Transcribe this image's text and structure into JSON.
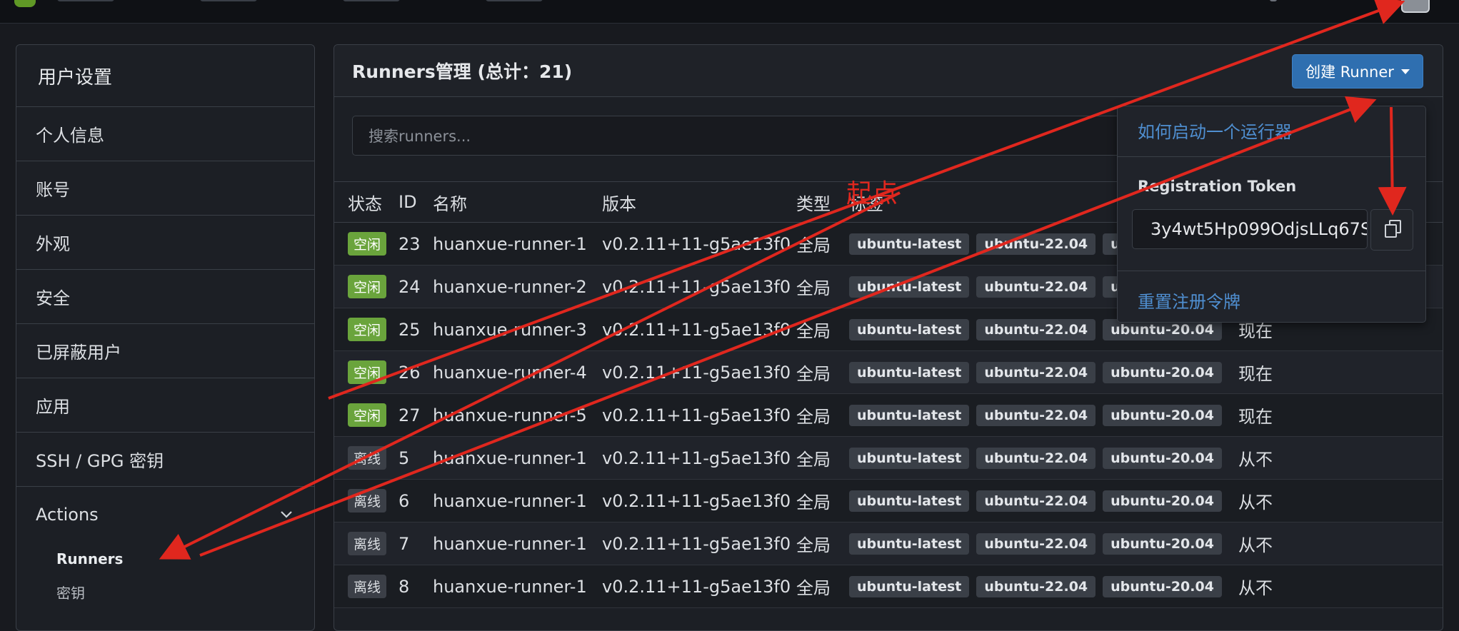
{
  "sidebar": {
    "title": "用户设置",
    "items": [
      {
        "label": "个人信息"
      },
      {
        "label": "账号"
      },
      {
        "label": "外观"
      },
      {
        "label": "安全"
      },
      {
        "label": "已屏蔽用户"
      },
      {
        "label": "应用"
      },
      {
        "label": "SSH / GPG 密钥"
      }
    ],
    "actions": {
      "label": "Actions",
      "chevron_icon": "chevron-down-icon",
      "subitems": [
        {
          "label": "Runners"
        },
        {
          "label": "密钥"
        }
      ]
    }
  },
  "main": {
    "title": "Runners管理 (总计：21)",
    "create_button": "创建 Runner",
    "search_placeholder": "搜索runners...",
    "columns": [
      "状态",
      "ID",
      "名称",
      "版本",
      "类型",
      "标签"
    ],
    "rows": [
      {
        "status": "空闲",
        "id": "23",
        "name": "huanxue-runner-1",
        "version": "v0.2.11+11-g5ae13f0",
        "type": "全局",
        "labels": [
          "ubuntu-latest",
          "ubuntu-22.04",
          "ub"
        ],
        "last": ""
      },
      {
        "status": "空闲",
        "id": "24",
        "name": "huanxue-runner-2",
        "version": "v0.2.11+11-g5ae13f0",
        "type": "全局",
        "labels": [
          "ubuntu-latest",
          "ubuntu-22.04",
          "ub"
        ],
        "last": ""
      },
      {
        "status": "空闲",
        "id": "25",
        "name": "huanxue-runner-3",
        "version": "v0.2.11+11-g5ae13f0",
        "type": "全局",
        "labels": [
          "ubuntu-latest",
          "ubuntu-22.04",
          "ubuntu-20.04"
        ],
        "last": "现在"
      },
      {
        "status": "空闲",
        "id": "26",
        "name": "huanxue-runner-4",
        "version": "v0.2.11+11-g5ae13f0",
        "type": "全局",
        "labels": [
          "ubuntu-latest",
          "ubuntu-22.04",
          "ubuntu-20.04"
        ],
        "last": "现在"
      },
      {
        "status": "空闲",
        "id": "27",
        "name": "huanxue-runner-5",
        "version": "v0.2.11+11-g5ae13f0",
        "type": "全局",
        "labels": [
          "ubuntu-latest",
          "ubuntu-22.04",
          "ubuntu-20.04"
        ],
        "last": "现在"
      },
      {
        "status": "离线",
        "id": "5",
        "name": "huanxue-runner-1",
        "version": "v0.2.11+11-g5ae13f0",
        "type": "全局",
        "labels": [
          "ubuntu-latest",
          "ubuntu-22.04",
          "ubuntu-20.04"
        ],
        "last": "从不"
      },
      {
        "status": "离线",
        "id": "6",
        "name": "huanxue-runner-1",
        "version": "v0.2.11+11-g5ae13f0",
        "type": "全局",
        "labels": [
          "ubuntu-latest",
          "ubuntu-22.04",
          "ubuntu-20.04"
        ],
        "last": "从不"
      },
      {
        "status": "离线",
        "id": "7",
        "name": "huanxue-runner-1",
        "version": "v0.2.11+11-g5ae13f0",
        "type": "全局",
        "labels": [
          "ubuntu-latest",
          "ubuntu-22.04",
          "ubuntu-20.04"
        ],
        "last": "从不"
      },
      {
        "status": "离线",
        "id": "8",
        "name": "huanxue-runner-1",
        "version": "v0.2.11+11-g5ae13f0",
        "type": "全局",
        "labels": [
          "ubuntu-latest",
          "ubuntu-22.04",
          "ubuntu-20.04"
        ],
        "last": "从不"
      }
    ]
  },
  "dropdown": {
    "start_link": "如何启动一个运行器",
    "token_label": "Registration Token",
    "token_value": "3y4wt5Hp099OdjsLLq67S",
    "reset_link": "重置注册令牌",
    "copy_icon": "copy-icon"
  },
  "annotation": {
    "text": "起点",
    "color": "#e0271e"
  },
  "colors": {
    "idle_badge": "#6aa43c",
    "offline_badge": "#3b3f47",
    "primary_button": "#2f6fb0",
    "link": "#4f8fd1"
  }
}
